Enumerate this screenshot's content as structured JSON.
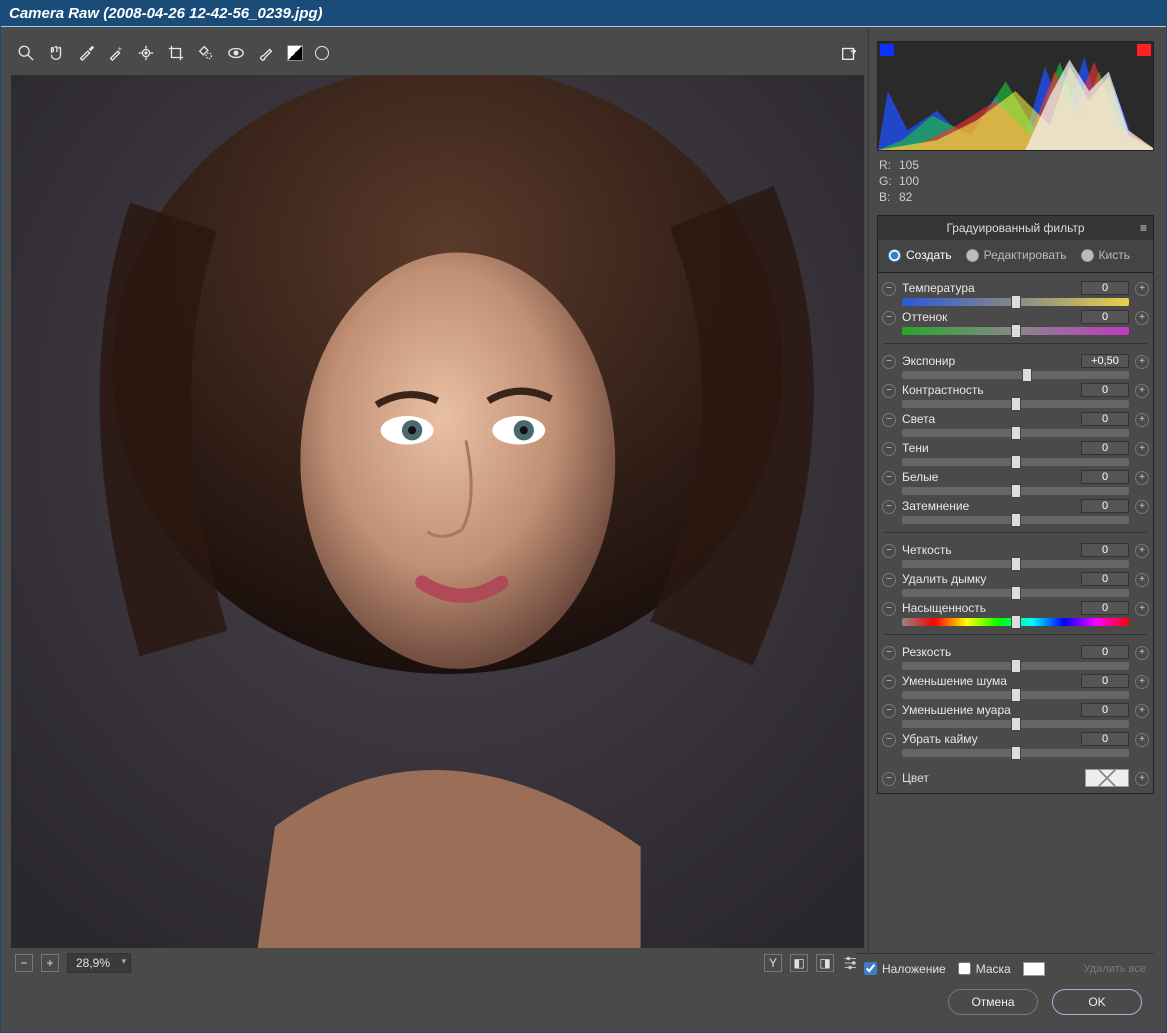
{
  "window": {
    "title": "Camera Raw (2008-04-26 12-42-56_0239.jpg)"
  },
  "rgb": {
    "r_label": "R:",
    "r": "105",
    "g_label": "G:",
    "g": "100",
    "b_label": "B:",
    "b": "82"
  },
  "panel": {
    "title": "Градуированный фильтр",
    "modes": {
      "create": "Создать",
      "edit": "Редактировать",
      "brush": "Кисть"
    },
    "colorLabel": "Цвет"
  },
  "sliders_group1": [
    {
      "label": "Температура",
      "value": "0",
      "knob": 50,
      "track": "grad-temp"
    },
    {
      "label": "Оттенок",
      "value": "0",
      "knob": 50,
      "track": "grad-tint"
    }
  ],
  "sliders_group2": [
    {
      "label": "Экспонир",
      "value": "+0,50",
      "knob": 55
    },
    {
      "label": "Контрастность",
      "value": "0",
      "knob": 50
    },
    {
      "label": "Света",
      "value": "0",
      "knob": 50
    },
    {
      "label": "Тени",
      "value": "0",
      "knob": 50
    },
    {
      "label": "Белые",
      "value": "0",
      "knob": 50
    },
    {
      "label": "Затемнение",
      "value": "0",
      "knob": 50
    }
  ],
  "sliders_group3": [
    {
      "label": "Четкость",
      "value": "0",
      "knob": 50
    },
    {
      "label": "Удалить дымку",
      "value": "0",
      "knob": 50
    },
    {
      "label": "Насыщенность",
      "value": "0",
      "knob": 50,
      "track": "grad-sat"
    }
  ],
  "sliders_group4": [
    {
      "label": "Резкость",
      "value": "0",
      "knob": 50
    },
    {
      "label": "Уменьшение шума",
      "value": "0",
      "knob": 50
    },
    {
      "label": "Уменьшение муара",
      "value": "0",
      "knob": 50
    },
    {
      "label": "Убрать кайму",
      "value": "0",
      "knob": 50
    }
  ],
  "overlay": {
    "overlay_label": "Наложение",
    "mask_label": "Маска",
    "clear": "Удалить все"
  },
  "zoom": {
    "value": "28,9%",
    "y": "Y"
  },
  "footer": {
    "cancel": "Отмена",
    "ok": "OK"
  }
}
